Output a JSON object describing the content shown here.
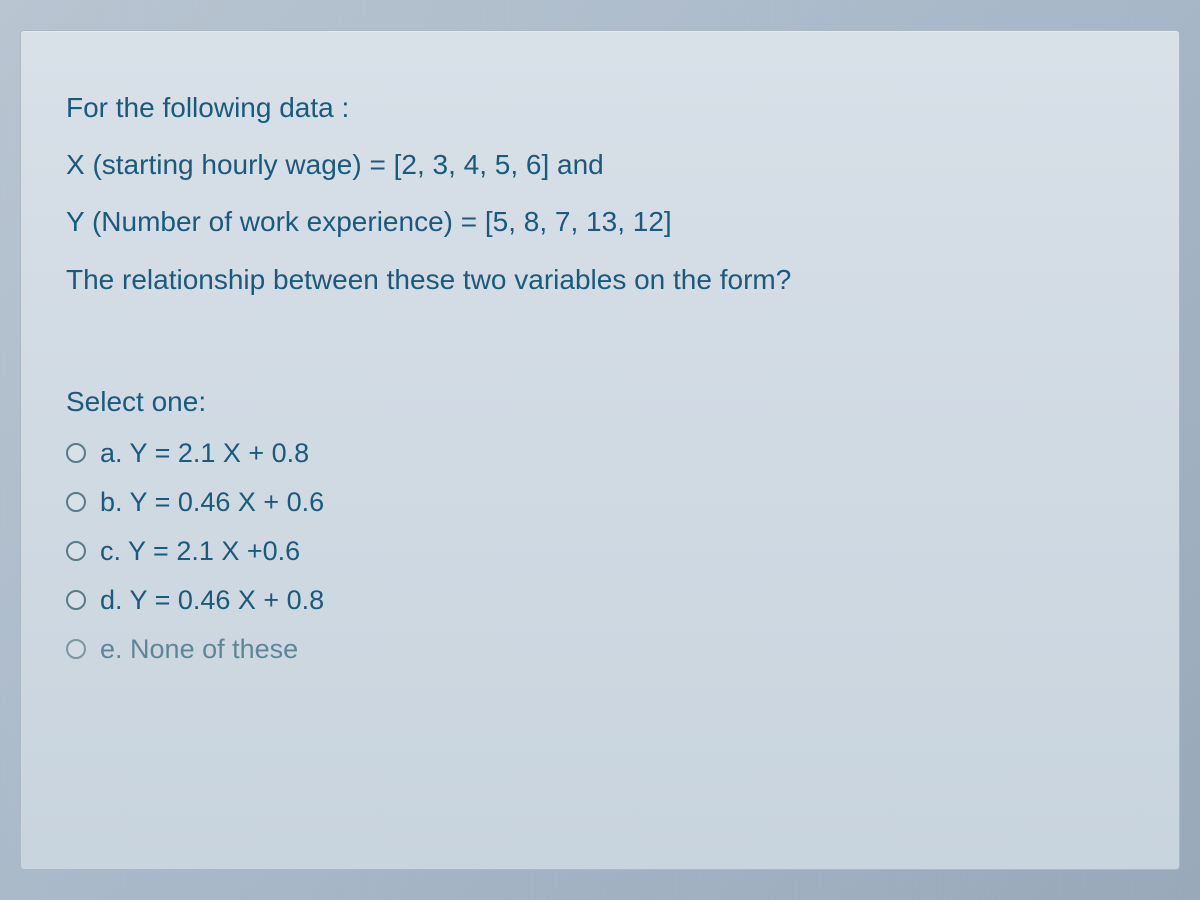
{
  "question": {
    "intro": "For the following data :",
    "x_label": "X (starting hourly wage)",
    "x_values": "= [2, 3, 4, 5, 6] and",
    "y_line": "Y (Number of work experience) = [5, 8, 7, 13, 12]",
    "prompt": "The  relationship between these two variables on the form?"
  },
  "select_prompt": "Select one:",
  "options": [
    {
      "letter": "a.",
      "text": "Y = 2.1 X + 0.8"
    },
    {
      "letter": "b.",
      "text": "Y = 0.46 X + 0.6"
    },
    {
      "letter": "c.",
      "text": "Y = 2.1 X +0.6"
    },
    {
      "letter": "d.",
      "text": "Y = 0.46 X + 0.8"
    },
    {
      "letter": "e.",
      "text": "None of these"
    }
  ]
}
